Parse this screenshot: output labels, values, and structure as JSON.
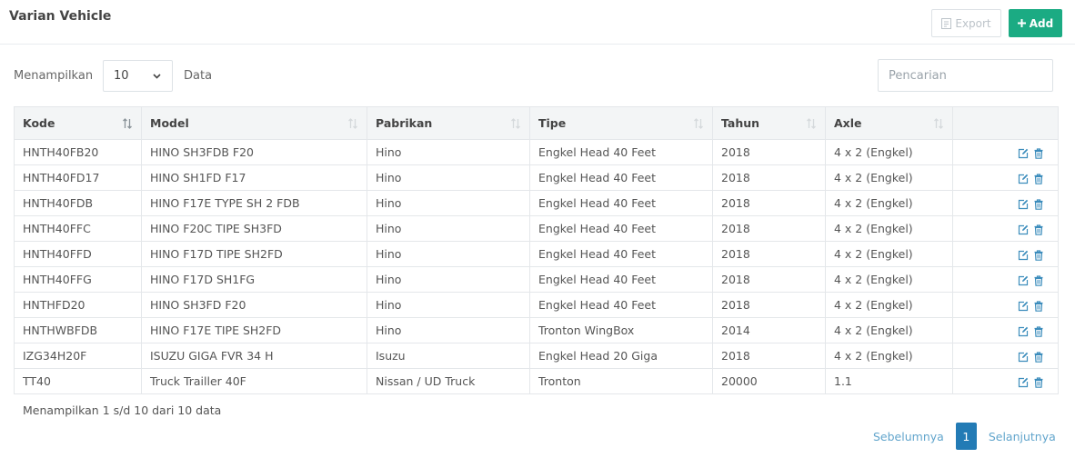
{
  "header": {
    "title": "Varian Vehicle",
    "export_label": "Export",
    "add_label": "Add"
  },
  "controls": {
    "show_label": "Menampilkan",
    "page_size": "10",
    "page_size_suffix": "Data",
    "search_placeholder": "Pencarian"
  },
  "table": {
    "columns": [
      "Kode",
      "Model",
      "Pabrikan",
      "Tipe",
      "Tahun",
      "Axle",
      ""
    ],
    "sorted_column": "Kode",
    "rows": [
      [
        "HNTH40FB20",
        "HINO SH3FDB F20",
        "Hino",
        "Engkel Head 40 Feet",
        "2018",
        "4 x 2 (Engkel)"
      ],
      [
        "HNTH40FD17",
        "HINO SH1FD F17",
        "Hino",
        "Engkel Head 40 Feet",
        "2018",
        "4 x 2 (Engkel)"
      ],
      [
        "HNTH40FDB",
        "HINO F17E TYPE SH 2 FDB",
        "Hino",
        "Engkel Head 40 Feet",
        "2018",
        "4 x 2 (Engkel)"
      ],
      [
        "HNTH40FFC",
        "HINO F20C TIPE SH3FD",
        "Hino",
        "Engkel Head 40 Feet",
        "2018",
        "4 x 2 (Engkel)"
      ],
      [
        "HNTH40FFD",
        "HINO F17D TIPE SH2FD",
        "Hino",
        "Engkel Head 40 Feet",
        "2018",
        "4 x 2 (Engkel)"
      ],
      [
        "HNTH40FFG",
        "HINO F17D SH1FG",
        "Hino",
        "Engkel Head 40 Feet",
        "2018",
        "4 x 2 (Engkel)"
      ],
      [
        "HNTHFD20",
        "HINO SH3FD F20",
        "Hino",
        "Engkel Head 40 Feet",
        "2018",
        "4 x 2 (Engkel)"
      ],
      [
        "HNTHWBFDB",
        "HINO F17E TIPE SH2FD",
        "Hino",
        "Tronton WingBox",
        "2014",
        "4 x 2 (Engkel)"
      ],
      [
        "IZG34H20F",
        "ISUZU GIGA FVR 34 H",
        "Isuzu",
        "Engkel Head 20 Giga",
        "2018",
        "4 x 2 (Engkel)"
      ],
      [
        "TT40",
        "Truck Trailler 40F",
        "Nissan / UD Truck",
        "Tronton",
        "20000",
        "1.1"
      ]
    ]
  },
  "footer": {
    "info": "Menampilkan 1 s/d 10 dari 10 data",
    "prev_label": "Sebelumnya",
    "current_page": "1",
    "next_label": "Selanjutnya"
  },
  "colors": {
    "add_button": "#1bab83",
    "active_page": "#237bb5",
    "link": "#62a5cc",
    "action_icon": "#3c8dbc"
  },
  "icons": {
    "export": "file-export-icon",
    "add": "plus-icon",
    "sort": "sort-icon",
    "edit": "edit-icon",
    "delete": "trash-icon"
  }
}
